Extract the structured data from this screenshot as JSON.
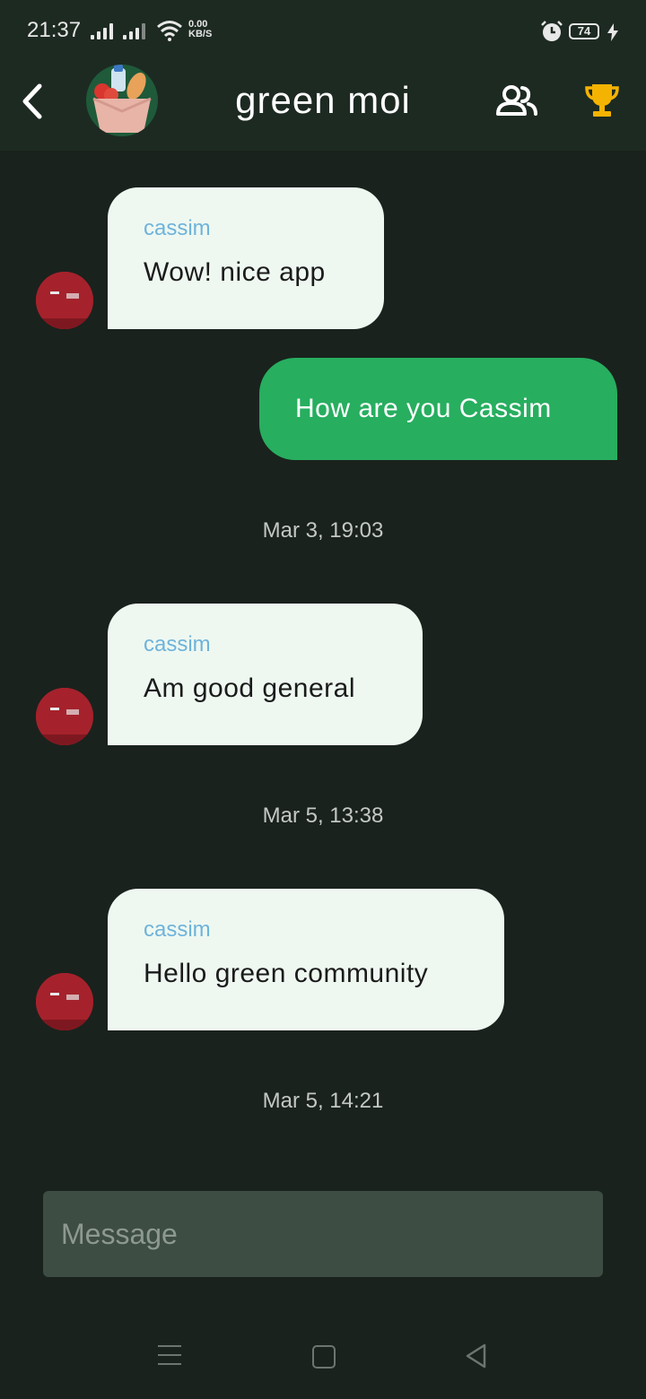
{
  "status_bar": {
    "time": "21:37",
    "net_speed_value": "0.00",
    "net_speed_unit": "KB/S",
    "battery": "74"
  },
  "header": {
    "title": "green moi",
    "icons": [
      "back-arrow-icon",
      "group-avatar",
      "members-icon",
      "trophy-icon"
    ],
    "trophy_color": "#f5b301"
  },
  "messages": [
    {
      "type": "incoming",
      "sender": "cassim",
      "text": "Wow! nice app"
    },
    {
      "type": "outgoing",
      "text": "How are you Cassim"
    },
    {
      "type": "timestamp",
      "text": "Mar 3, 19:03"
    },
    {
      "type": "incoming",
      "sender": "cassim",
      "text": "Am good general"
    },
    {
      "type": "timestamp",
      "text": "Mar 5, 13:38"
    },
    {
      "type": "incoming",
      "sender": "cassim",
      "text": "Hello green community"
    },
    {
      "type": "timestamp",
      "text": "Mar 5, 14:21"
    }
  ],
  "composer": {
    "placeholder": "Message"
  },
  "colors": {
    "background": "#1a221d",
    "header": "#1d2a22",
    "incoming_bubble": "#eef8f1",
    "outgoing_bubble": "#27ae5f",
    "sender_name": "#6fb3da"
  }
}
